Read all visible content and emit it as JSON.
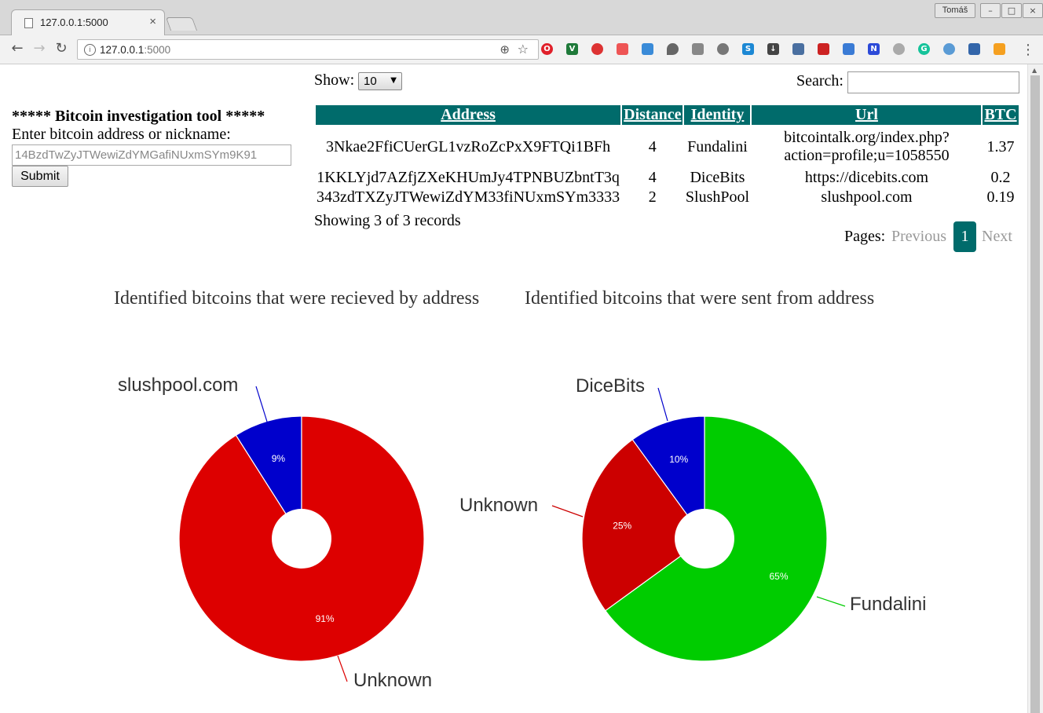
{
  "browser": {
    "tab_title": "127.0.0.1:5000",
    "tab_close": "×",
    "user_name": "Tomáš",
    "url_host": "127.0.0.1",
    "url_port": ":5000",
    "win_min": "–",
    "win_max": "□",
    "win_close": "×"
  },
  "form": {
    "title": "***** Bitcoin investigation tool *****",
    "label": "Enter bitcoin address or nickname:",
    "input_value": "14BzdTwZyJTWewiZdYMGafiNUxmSYm9K91",
    "submit_label": "Submit"
  },
  "table_controls": {
    "show_label": "Show:",
    "show_value": "10",
    "search_label": "Search:"
  },
  "table": {
    "headers": [
      "Address",
      "Distance",
      "Identity",
      "Url",
      "BTC"
    ],
    "rows": [
      {
        "address": "3Nkae2FfiCUerGL1vzRoZcPxX9FTQi1BFh",
        "distance": "4",
        "identity": "Fundalini",
        "url_line1": "bitcointalk.org/index.php?",
        "url_line2": "action=profile;u=1058550",
        "btc": "1.37"
      },
      {
        "address": "1KKLYjd7AZfjZXeKHUmJy4TPNBUZbntT3q",
        "distance": "4",
        "identity": "DiceBits",
        "url_line1": "https://dicebits.com",
        "url_line2": "",
        "btc": "0.2"
      },
      {
        "address": "343zdTXZyJTWewiZdYM33fiNUxmSYm3333",
        "distance": "2",
        "identity": "SlushPool",
        "url_line1": "slushpool.com",
        "url_line2": "",
        "btc": "0.19"
      }
    ],
    "showing": "Showing 3 of 3 records"
  },
  "pagination": {
    "pages_label": "Pages:",
    "previous": "Previous",
    "current": "1",
    "next": "Next"
  },
  "chart_data": [
    {
      "type": "pie",
      "title": "Identified bitcoins that were recieved by address",
      "slices": [
        {
          "label": "slushpool.com",
          "value": 9,
          "pct_label": "9%",
          "color": "#0000cc"
        },
        {
          "label": "Unknown",
          "value": 91,
          "pct_label": "91%",
          "color": "#dd0000"
        }
      ]
    },
    {
      "type": "pie",
      "title": "Identified bitcoins that were sent from address",
      "slices": [
        {
          "label": "Fundalini",
          "value": 65,
          "pct_label": "65%",
          "color": "#00cc00"
        },
        {
          "label": "Unknown",
          "value": 25,
          "pct_label": "25%",
          "color": "#cc0000"
        },
        {
          "label": "DiceBits",
          "value": 10,
          "pct_label": "10%",
          "color": "#0000cc"
        }
      ]
    }
  ]
}
